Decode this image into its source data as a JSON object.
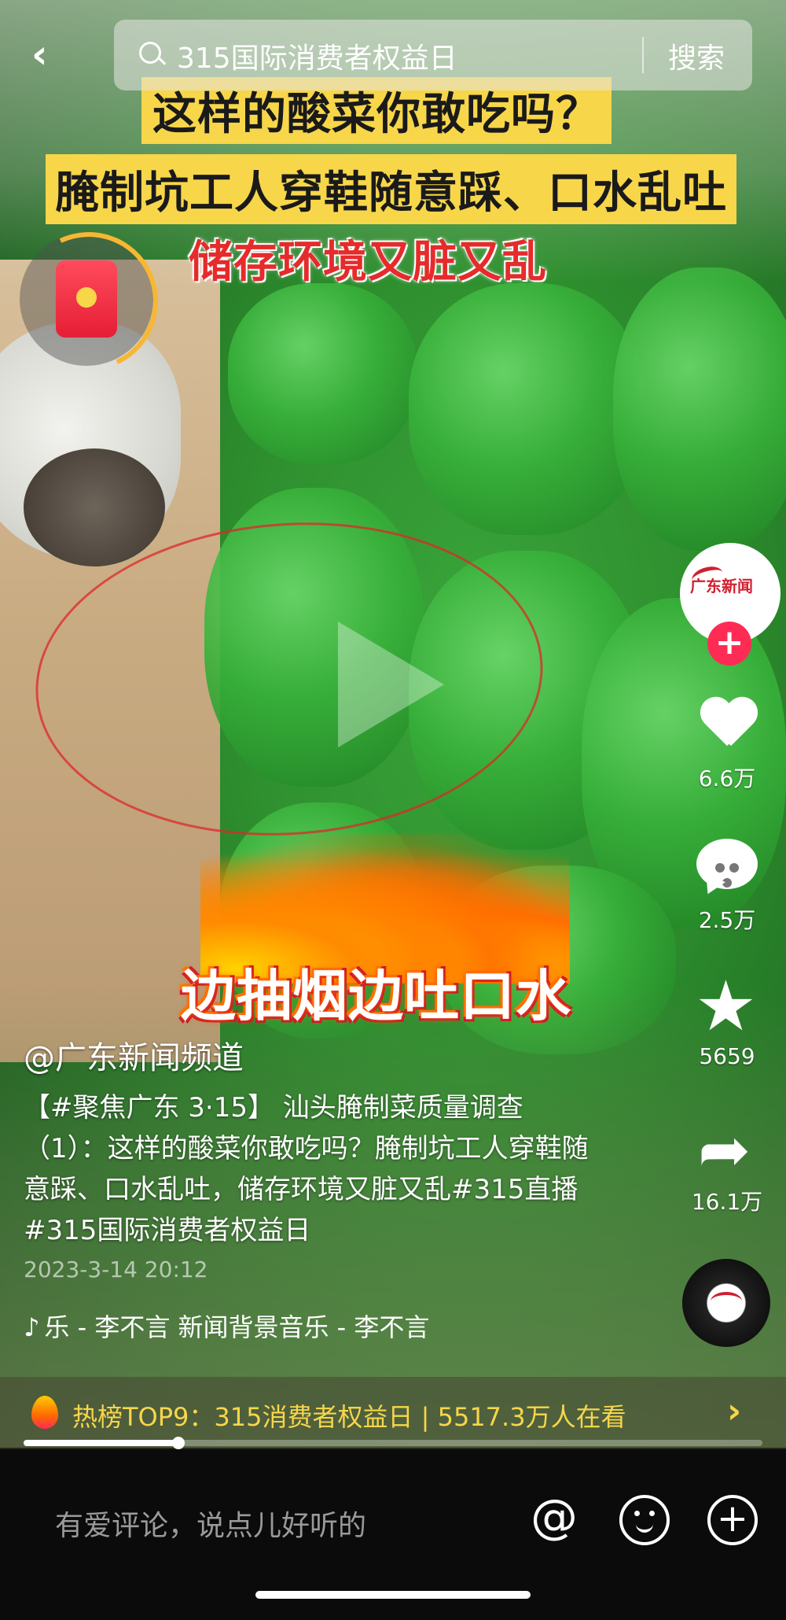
{
  "search": {
    "query": "315国际消费者权益日",
    "button": "搜索"
  },
  "captions": {
    "line1": "这样的酸菜你敢吃吗？",
    "line2": "腌制坑工人穿鞋随意踩、口水乱吐",
    "line3": "储存环境又脏又乱",
    "line4": "边抽烟边吐口水"
  },
  "creator": {
    "logo_text": "广东新闻",
    "handle": "@广东新闻频道"
  },
  "actions": {
    "likes": "6.6万",
    "comments": "2.5万",
    "favorites": "5659",
    "shares": "16.1万"
  },
  "post": {
    "description": "【#聚焦广东 3·15】 汕头腌制菜质量调查（1）：这样的酸菜你敢吃吗？腌制坑工人穿鞋随意踩、口水乱吐，储存环境又脏又乱#315直播#315国际消费者权益日",
    "date": "2023-3-14 20:12",
    "music": "乐 - 李不言    新闻背景音乐 - 李不言"
  },
  "hot": {
    "text": "热榜TOP9：315消费者权益日 | 5517.3万人在看"
  },
  "playback": {
    "progress": 0.21
  },
  "comment_bar": {
    "placeholder": "有爱评论，说点儿好听的"
  },
  "colors": {
    "accent": "#fe2c55",
    "hot_yellow": "#f7d64a",
    "caption_bg": "#f7d64a",
    "caption_red": "#e52b2b"
  },
  "icons": [
    "back-icon",
    "search-icon",
    "red-packet-icon",
    "play-icon",
    "heart-icon",
    "comment-icon",
    "star-icon",
    "share-icon",
    "music-disc-icon",
    "fire-icon",
    "chevron-right-icon",
    "at-icon",
    "emoji-icon",
    "plus-icon"
  ]
}
